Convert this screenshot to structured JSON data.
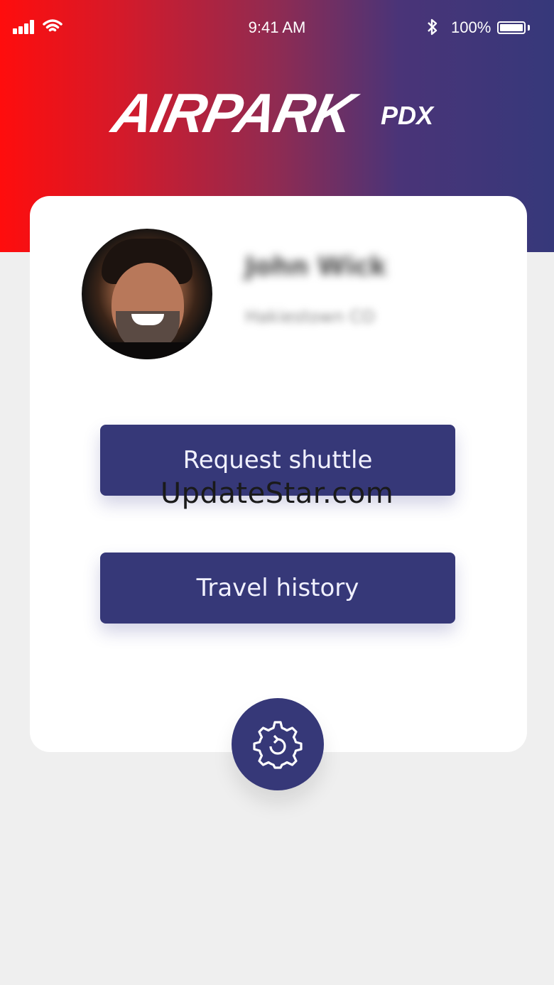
{
  "status_bar": {
    "time": "9:41 AM",
    "battery_percent": "100%"
  },
  "brand": {
    "logo_main": "AIRPARK",
    "logo_sub": "PDX"
  },
  "profile": {
    "name": "John Wick",
    "subtitle": "Hakiestown CO"
  },
  "actions": {
    "request_shuttle": "Request shuttle",
    "travel_history": "Travel history"
  },
  "watermark": "UpdateStar.com",
  "icons": {
    "settings": "gear-icon"
  },
  "colors": {
    "primary": "#363878",
    "gradient_start": "#ff0d0d",
    "gradient_end": "#36387a",
    "background": "#efefef"
  }
}
